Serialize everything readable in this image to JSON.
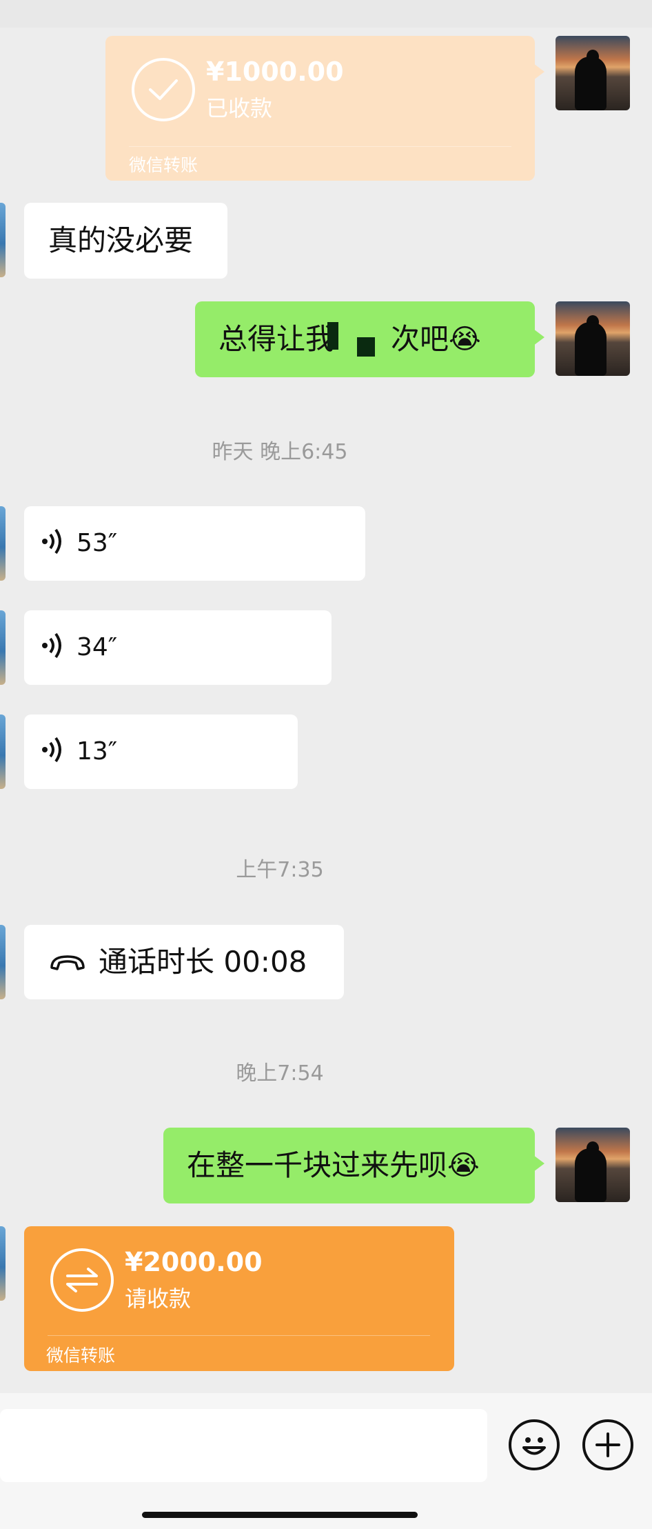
{
  "messages": {
    "transfer_received": {
      "amount": "¥1000.00",
      "status": "已收款",
      "footer": "微信转账"
    },
    "msg_peer_1": "真的没必要",
    "msg_self_1_a": "总得让我",
    "msg_self_1_b": "次吧",
    "msg_self_1_emoji": "😭",
    "time_1": "昨天 晚上6:45",
    "voice_1": "53″",
    "voice_2": "34″",
    "voice_3": "13″",
    "time_2": "上午7:35",
    "call_label": "通话时长 00:08",
    "time_3": "晚上7:54",
    "msg_self_2": "在整一千块过来先呗",
    "msg_self_2_emoji": "😭",
    "transfer_pending": {
      "amount": "¥2000.00",
      "status": "请收款",
      "footer": "微信转账"
    }
  },
  "input_bar": {
    "emoji_icon": "smiley-icon",
    "more_icon": "plus-icon"
  },
  "colors": {
    "received_card": "#fde1c3",
    "pending_card": "#f9a03c",
    "self_bubble": "#95ec69",
    "peer_bubble": "#ffffff"
  }
}
